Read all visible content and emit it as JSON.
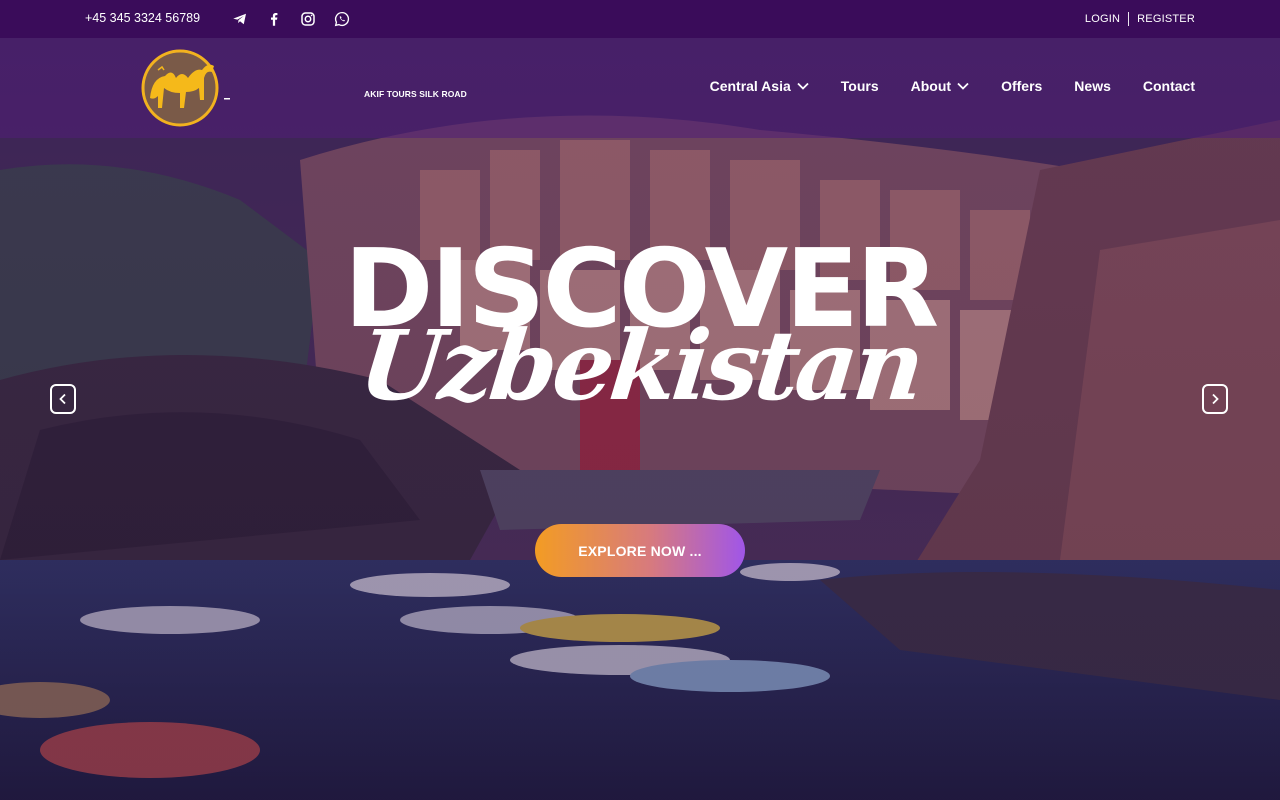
{
  "topbar": {
    "phone": "+45 345 3324 56789",
    "social": [
      "telegram-icon",
      "facebook-icon",
      "instagram-icon",
      "whatsapp-icon"
    ],
    "login": "LOGIN",
    "register": "REGISTER"
  },
  "brand": {
    "name": "AKIF TOURS SILK ROAD"
  },
  "nav": {
    "items": [
      {
        "label": "Central Asia",
        "dropdown": true
      },
      {
        "label": "Tours",
        "dropdown": false
      },
      {
        "label": "About",
        "dropdown": true
      },
      {
        "label": "Offers",
        "dropdown": false
      },
      {
        "label": "News",
        "dropdown": false
      },
      {
        "label": "Contact",
        "dropdown": false
      }
    ]
  },
  "hero": {
    "headline": "DISCOVER",
    "subheadline": "Uzbekistan",
    "cta": "EXPLORE NOW ..."
  },
  "colors": {
    "topbar": "#3a0c5a",
    "cta_start": "#f39c23",
    "cta_end": "#a056e8"
  }
}
